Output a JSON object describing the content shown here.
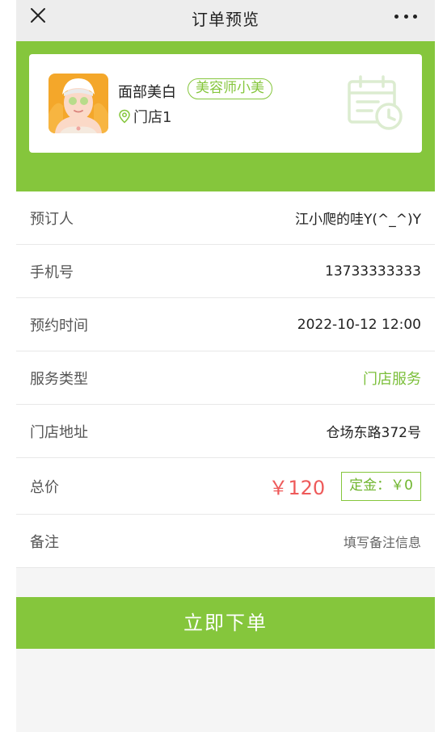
{
  "header": {
    "title": "订单预览"
  },
  "service": {
    "name": "面部美白",
    "beautician": "美容师小美",
    "store": "门店1"
  },
  "rows": {
    "booker": {
      "label": "预订人",
      "value": "江小爬的哇Y(^_^)Y"
    },
    "phone": {
      "label": "手机号",
      "value": "13733333333"
    },
    "time": {
      "label": "预约时间",
      "value": "2022-10-12 12:00"
    },
    "service_type": {
      "label": "服务类型",
      "value": "门店服务"
    },
    "address": {
      "label": "门店地址",
      "value": "仓场东路372号"
    },
    "total": {
      "label": "总价",
      "price": "￥120",
      "deposit": "定金：￥0"
    },
    "remark": {
      "label": "备注",
      "placeholder": "填写备注信息"
    }
  },
  "submit": {
    "label": "立即下单"
  },
  "colors": {
    "accent": "#85c63c",
    "price": "#ee5a5a",
    "header_bg": "#ededed"
  },
  "icons": [
    "close-icon",
    "more-icon",
    "location-pin-icon",
    "calendar-clock-icon"
  ]
}
